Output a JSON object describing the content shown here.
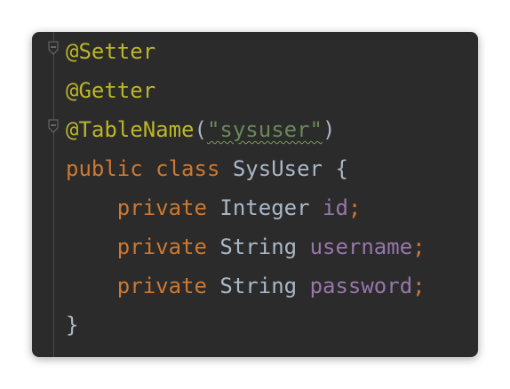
{
  "editor": {
    "lines": [
      {
        "annotation": "@Setter"
      },
      {
        "annotation": "@Getter"
      },
      {
        "annotation": "@TableName",
        "open": "(",
        "string": "\"sysuser\"",
        "close": ")"
      },
      {
        "kw1": "public",
        "kw2": "class",
        "name": "SysUser",
        "brace": "{"
      },
      {
        "kw": "private",
        "type": "Integer",
        "field": "id",
        "semi": ";"
      },
      {
        "kw": "private",
        "type": "String",
        "field": "username",
        "semi": ";"
      },
      {
        "kw": "private",
        "type": "String",
        "field": "password",
        "semi": ";"
      },
      {
        "brace": "}"
      }
    ]
  },
  "colors": {
    "background": "#2b2b2b",
    "annotation": "#bbb529",
    "keyword": "#cc7832",
    "string": "#6a8759",
    "field": "#9876aa",
    "text": "#a9b7c6"
  },
  "icons": [
    "fold-icon"
  ]
}
